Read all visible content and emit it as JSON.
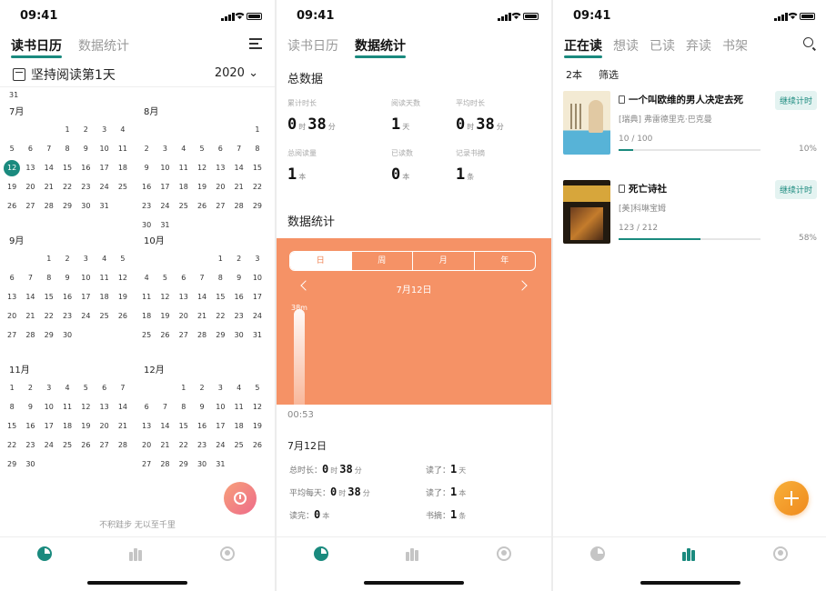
{
  "status_bar": {
    "time": "09:41"
  },
  "screen1": {
    "tabs": [
      "读书日历",
      "数据统计"
    ],
    "streak": "坚持阅读第1天",
    "year": "2020",
    "prev_day": "31",
    "months": [
      {
        "name": "7月",
        "offset": 3,
        "days": 31,
        "today": 12
      },
      {
        "name": "8月",
        "offset": 6,
        "days": 31
      },
      {
        "name": "9月",
        "offset": 2,
        "days": 30
      },
      {
        "name": "10月",
        "offset": 4,
        "days": 31
      },
      {
        "name": "11月",
        "offset": 0,
        "days": 30
      },
      {
        "name": "12月",
        "offset": 2,
        "days": 31
      }
    ],
    "motto": "不积跬步 无以至千里"
  },
  "screen2": {
    "tabs": [
      "读书日历",
      "数据统计"
    ],
    "total_title": "总数据",
    "totals": [
      {
        "label": "累计时长",
        "v1": "0",
        "u1": "时",
        "v2": "38",
        "u2": "分"
      },
      {
        "label": "阅读天数",
        "v1": "1",
        "u1": "天"
      },
      {
        "label": "平均时长",
        "v1": "0",
        "u1": "时",
        "v2": "38",
        "u2": "分"
      },
      {
        "label": "总阅读量",
        "v1": "1",
        "u1": "本"
      },
      {
        "label": "已读数",
        "v1": "0",
        "u1": "本"
      },
      {
        "label": "记录书摘",
        "v1": "1",
        "u1": "条"
      }
    ],
    "stats_title": "数据统计",
    "periods": [
      "日",
      "周",
      "月",
      "年"
    ],
    "active_period": 0,
    "chart_date": "7月12日",
    "chart_data": {
      "type": "bar",
      "categories": [
        "00:53"
      ],
      "values": [
        38
      ],
      "value_labels": [
        "38m"
      ]
    },
    "day_title": "7月12日",
    "day_stats": {
      "total_label": "总时长：",
      "total_h": "0",
      "total_m": "38",
      "avg_label": "平均每天：",
      "avg_h": "0",
      "avg_m": "38",
      "finished_label": "读完：",
      "finished": "0",
      "read_days_label": "读了：",
      "read_days": "1",
      "read_books_label": "读了：",
      "read_books": "1",
      "notes_label": "书摘：",
      "notes": "1",
      "unit_h": "时",
      "unit_m": "分",
      "unit_day": "天",
      "unit_book": "本",
      "unit_note": "条"
    }
  },
  "screen3": {
    "tabs": [
      "正在读",
      "想读",
      "已读",
      "弃读",
      "书架"
    ],
    "count": "2本",
    "filter": "筛选",
    "books": [
      {
        "title": "一个叫欧维的男人决定去死",
        "author": "[瑞典] 弗雷德里克·巴克曼",
        "progress": "10 / 100",
        "percent": "10%",
        "fraction": 0.1,
        "button": "继续计时"
      },
      {
        "title": "死亡诗社",
        "author": "[美]科琳宝姆",
        "progress": "123 / 212",
        "percent": "58%",
        "fraction": 0.58,
        "button": "继续计时"
      }
    ]
  },
  "nav": {
    "active_color": "#1a8a7e",
    "inactive_color": "#c5c5c5"
  }
}
